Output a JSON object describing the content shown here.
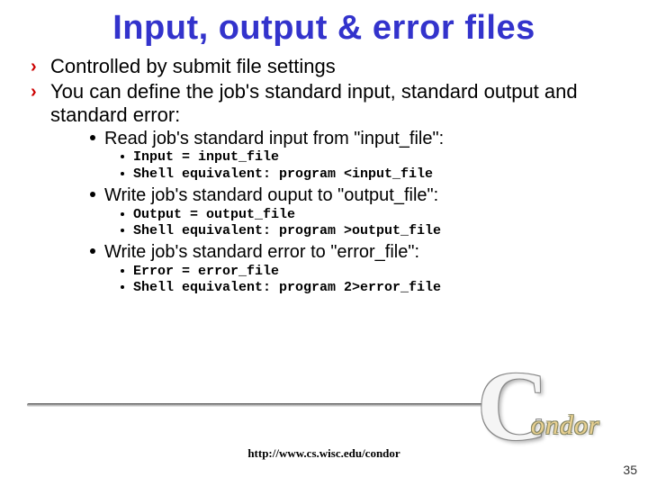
{
  "title": "Input, output & error files",
  "bullets": {
    "b1": "Controlled by submit file settings",
    "b2": "You can define the job's standard input, standard output and standard error:"
  },
  "sub": {
    "s1": "Read job's standard input from \"input_file\":",
    "s1a": "Input   = input_file",
    "s1b": "Shell equivalent: program <input_file",
    "s2": "Write job's standard ouput to \"output_file\":",
    "s2a": "Output  = output_file",
    "s2b": "Shell equivalent: program >output_file",
    "s3": "Write job's standard error to \"error_file\":",
    "s3a": "Error   = error_file",
    "s3b": "Shell equivalent: program 2>error_file"
  },
  "footer": {
    "url": "http://www.cs.wisc.edu/condor",
    "page": "35"
  },
  "logo": {
    "c": "C",
    "word": "ondor"
  }
}
